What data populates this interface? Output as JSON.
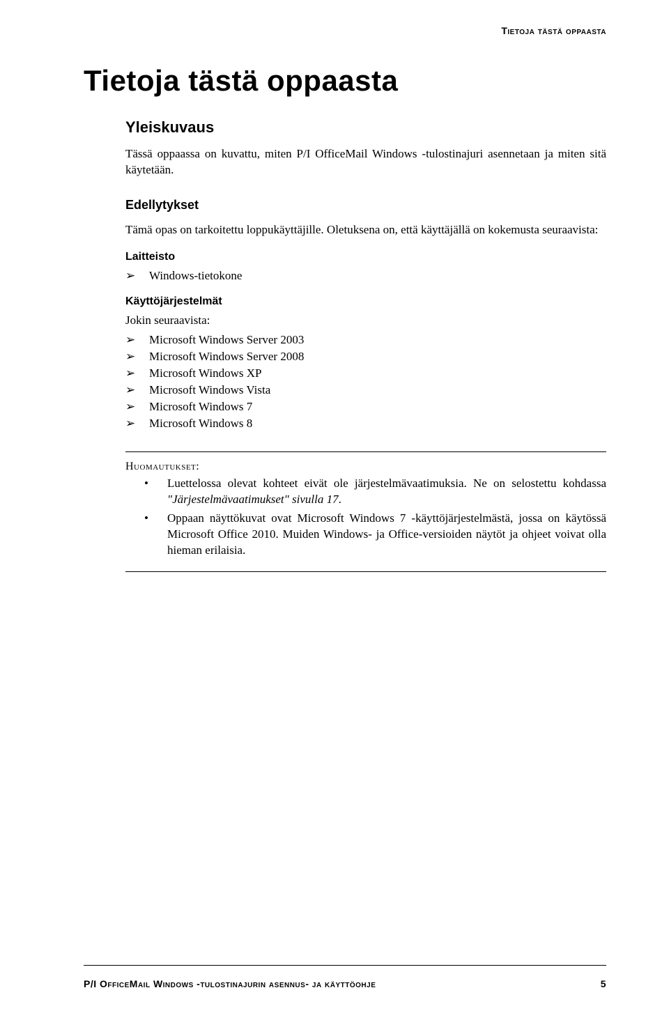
{
  "header": {
    "running_head": "Tietoja tästä oppaasta"
  },
  "title": "Tietoja tästä oppaasta",
  "overview": {
    "heading": "Yleiskuvaus",
    "paragraph": "Tässä oppaassa on kuvattu, miten P/I OfficeMail Windows -tulostinajuri asennetaan ja miten sitä käytetään."
  },
  "prerequisites": {
    "heading": "Edellytykset",
    "paragraph": "Tämä opas on tarkoitettu loppukäyttäjille. Oletuksena on, että käyttäjällä on kokemusta seuraavista:",
    "hardware": {
      "heading": "Laitteisto",
      "items": [
        "Windows-tietokone"
      ]
    },
    "os": {
      "heading": "Käyttöjärjestelmät",
      "intro": "Jokin seuraavista:",
      "items": [
        "Microsoft Windows Server 2003",
        "Microsoft Windows Server 2008",
        "Microsoft Windows XP",
        "Microsoft Windows Vista",
        "Microsoft Windows 7",
        "Microsoft Windows 8"
      ]
    }
  },
  "notes": {
    "heading": "Huomautukset:",
    "items": [
      {
        "pre": "Luettelossa olevat kohteet eivät ole järjestelmävaatimuksia. Ne on selostettu kohdassa ",
        "link": "\"Järjestelmävaatimukset\" sivulla 17",
        "post": "."
      },
      {
        "pre": "Oppaan näyttökuvat ovat Microsoft Windows 7 -käyttöjärjestelmästä, jossa on käytössä Microsoft Office 2010. Muiden Windows- ja Office-versioiden näytöt ja ohjeet voivat olla hieman erilaisia.",
        "link": "",
        "post": ""
      }
    ]
  },
  "footer": {
    "left": "P/I OfficeMail Windows -tulostinajurin asennus- ja käyttöohje",
    "right": "5"
  },
  "glyphs": {
    "arrow": "➢",
    "dot": "•"
  }
}
